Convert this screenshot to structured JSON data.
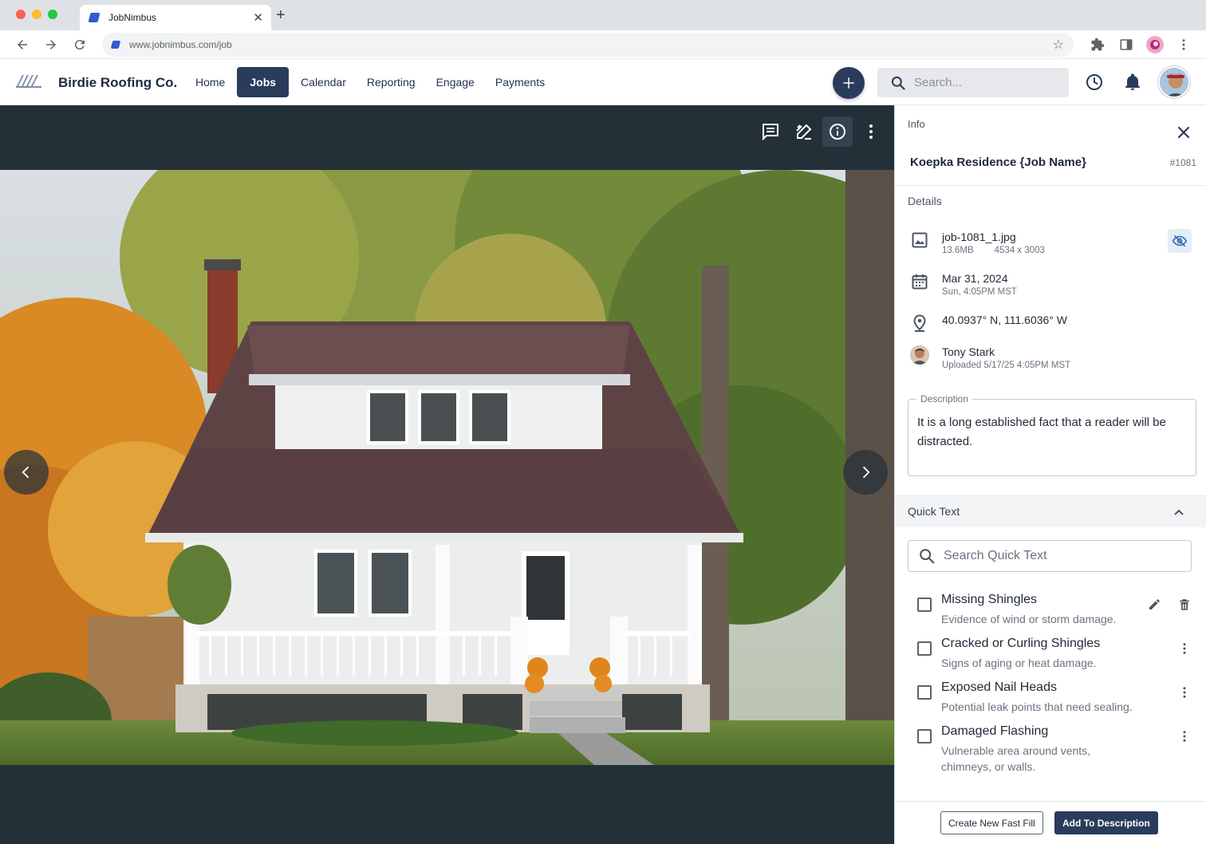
{
  "browser": {
    "tab_title": "JobNimbus",
    "url": "www.jobnimbus.com/job"
  },
  "header": {
    "brand": "Birdie Roofing Co.",
    "nav": [
      "Home",
      "Jobs",
      "Calendar",
      "Reporting",
      "Engage",
      "Payments"
    ],
    "active_nav": "Jobs",
    "search_placeholder": "Search..."
  },
  "panel": {
    "section_title": "Info",
    "job_name": "Koepka Residence {Job Name}",
    "job_number": "#1081",
    "details_title": "Details",
    "file": {
      "name": "job-1081_1.jpg",
      "size": "13.6MB",
      "dimensions": "4534 x 3003"
    },
    "date": {
      "main": "Mar 31, 2024",
      "sub": "Sun, 4:05PM MST"
    },
    "location": "40.0937° N, 111.6036° W",
    "uploader": {
      "name": "Tony Stark",
      "sub": "Uploaded 5/17/25 4:05PM MST"
    },
    "description": {
      "label": "Description",
      "text": "It is a long established fact that a reader will be distracted."
    },
    "quick_text": {
      "title": "Quick Text",
      "search_placeholder": "Search Quick Text",
      "items": [
        {
          "title": "Missing Shingles",
          "subtitle": "Evidence of wind or storm damage."
        },
        {
          "title": "Cracked or Curling Shingles",
          "subtitle": "Signs of aging or heat damage."
        },
        {
          "title": "Exposed Nail Heads",
          "subtitle": "Potential leak points that need sealing."
        },
        {
          "title": "Damaged Flashing",
          "subtitle": "Vulnerable area around vents, chimneys, or walls."
        }
      ]
    },
    "footer": {
      "secondary_label": "Create New Fast Fill",
      "primary_label": "Add To Description"
    }
  },
  "colors": {
    "primary": "#2b3b5c",
    "viewer_bg": "#243038"
  }
}
